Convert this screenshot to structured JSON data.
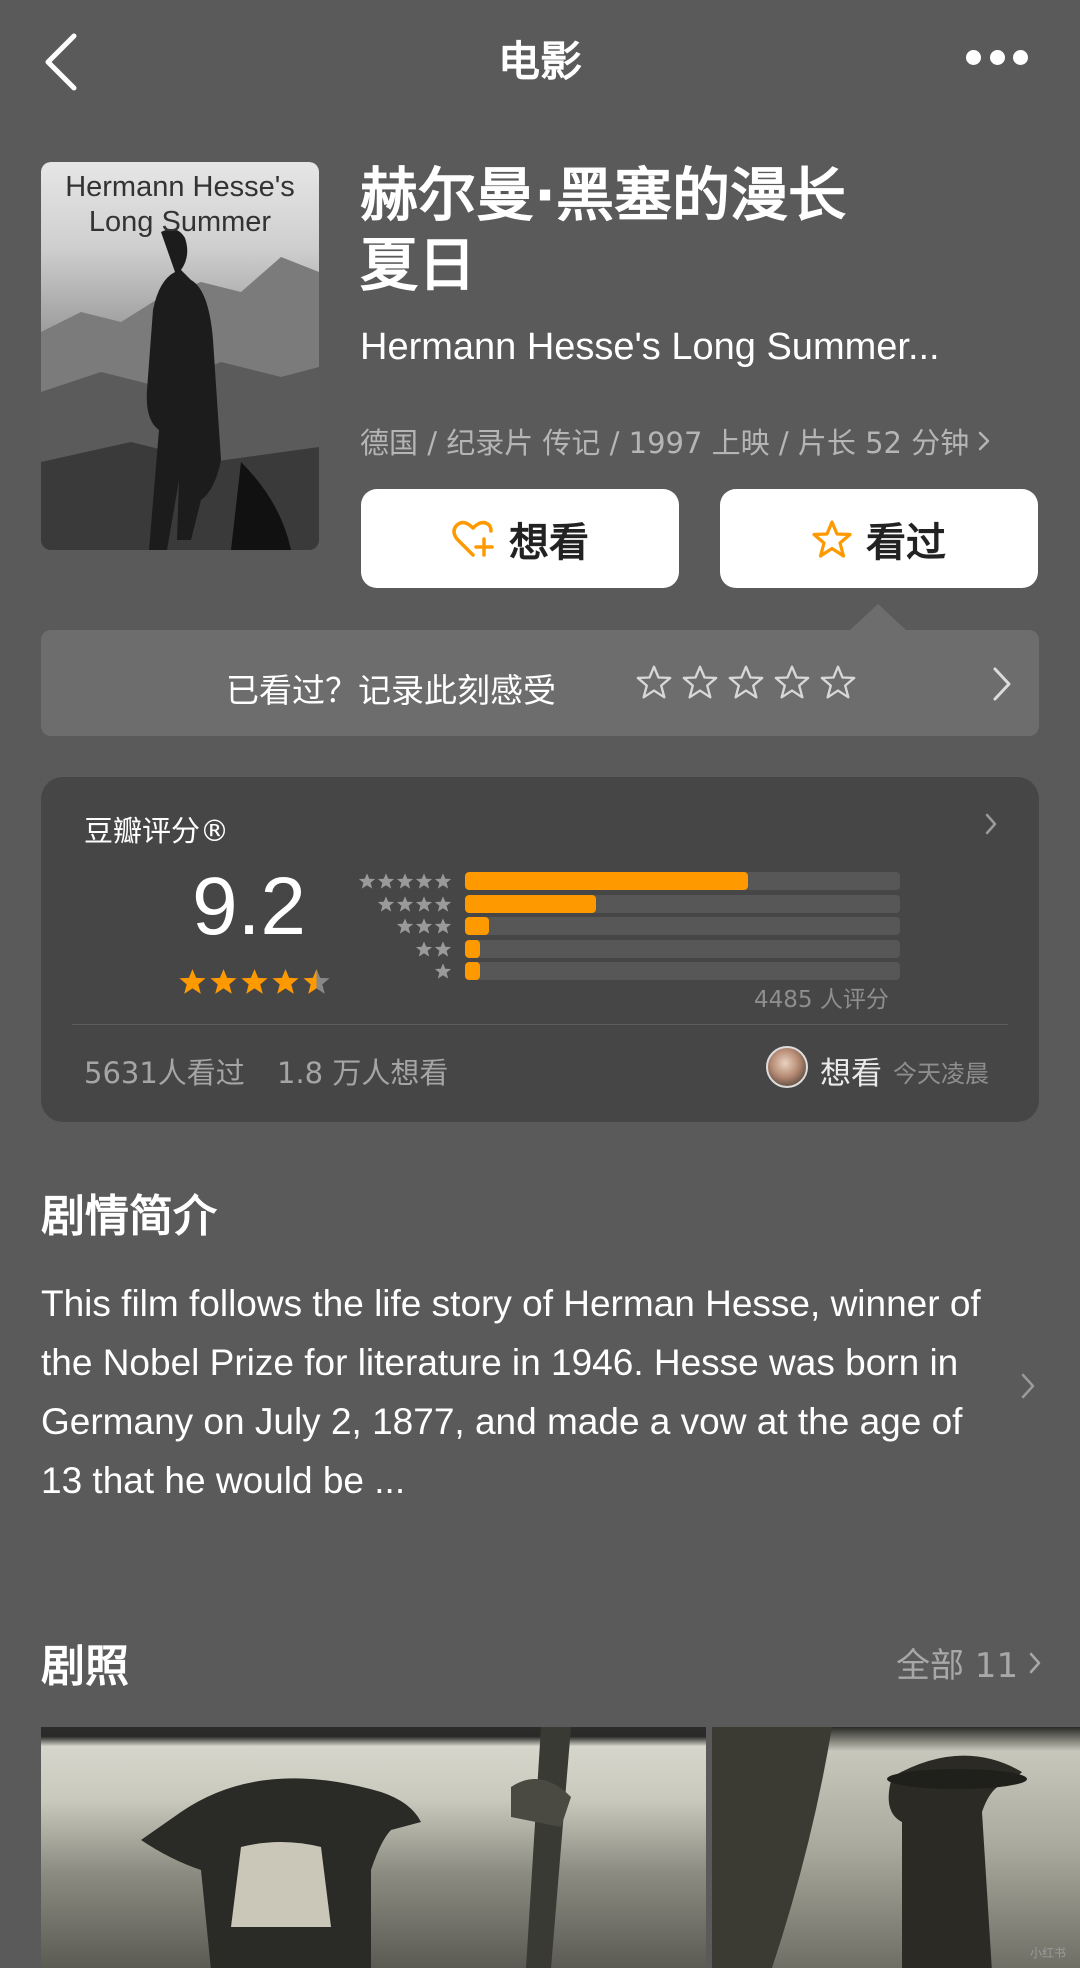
{
  "nav": {
    "title": "电影"
  },
  "poster": {
    "title_line1": "Hermann Hesse's",
    "title_line2": "Long Summer"
  },
  "movie": {
    "title_zh_line1": "赫尔曼·黑塞的漫长",
    "title_zh_line2": "夏日",
    "title_en": "Hermann Hesse's Long Summer...",
    "meta": "德国 / 纪录片 传记 / 1997 上映 / 片长 52 分钟"
  },
  "actions": {
    "want_label": "想看",
    "seen_label": "看过"
  },
  "rate_prompt": {
    "text": "已看过？记录此刻感受",
    "star_count": 5
  },
  "rating": {
    "title": "豆瓣评分®",
    "score": "9.2",
    "stars": 4.5,
    "distribution": [
      {
        "stars": 5,
        "fraction": 0.65
      },
      {
        "stars": 4,
        "fraction": 0.3
      },
      {
        "stars": 3,
        "fraction": 0.055
      },
      {
        "stars": 2,
        "fraction": 0.035
      },
      {
        "stars": 1,
        "fraction": 0.035
      }
    ],
    "count_text": "4485 人评分",
    "seen_text": "5631人看过",
    "want_text": "1.8 万人想看",
    "friend_status": "想看",
    "friend_time": "今天凌晨"
  },
  "synopsis": {
    "heading": "剧情简介",
    "body": "This film follows the life story of Herman Hesse, winner of the Nobel Prize for literature in 1946. Hesse was born in Germany on July 2, 1877, and made a vow at the age of 13 that he would be ..."
  },
  "stills": {
    "heading": "剧照",
    "all_label": "全部 11"
  },
  "watermark": "小红书",
  "colors": {
    "accent": "#ff9900",
    "background": "#5a5a5a",
    "card": "#464646"
  }
}
